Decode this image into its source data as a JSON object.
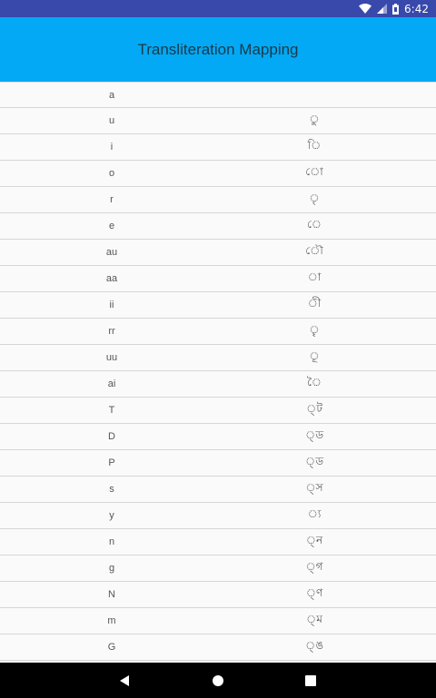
{
  "status_bar": {
    "time": "6:42",
    "icons": [
      "wifi-icon",
      "signal-icon",
      "battery-icon"
    ]
  },
  "app_bar": {
    "title": "Transliteration Mapping",
    "color": "#03a9f4"
  },
  "mappings": [
    {
      "latin": "a",
      "bengali": ""
    },
    {
      "latin": "u",
      "bengali": "ু"
    },
    {
      "latin": "i",
      "bengali": "ি"
    },
    {
      "latin": "o",
      "bengali": "ো"
    },
    {
      "latin": "r",
      "bengali": "ৃ"
    },
    {
      "latin": "e",
      "bengali": "ে"
    },
    {
      "latin": "au",
      "bengali": "ৌ"
    },
    {
      "latin": "aa",
      "bengali": "া"
    },
    {
      "latin": "ii",
      "bengali": "ী"
    },
    {
      "latin": "rr",
      "bengali": "ৄ"
    },
    {
      "latin": "uu",
      "bengali": "ূ"
    },
    {
      "latin": "ai",
      "bengali": "ৈ"
    },
    {
      "latin": "T",
      "bengali": "্ট"
    },
    {
      "latin": "D",
      "bengali": "্ড"
    },
    {
      "latin": "P",
      "bengali": "্ড"
    },
    {
      "latin": "s",
      "bengali": "্স"
    },
    {
      "latin": "y",
      "bengali": "্য"
    },
    {
      "latin": "n",
      "bengali": "্ন"
    },
    {
      "latin": "g",
      "bengali": "্গ"
    },
    {
      "latin": "N",
      "bengali": "্ণ"
    },
    {
      "latin": "m",
      "bengali": "্ম"
    },
    {
      "latin": "G",
      "bengali": "্ঙ"
    }
  ],
  "nav_bar": {
    "icons": [
      "back-icon",
      "home-icon",
      "recent-apps-icon"
    ]
  }
}
